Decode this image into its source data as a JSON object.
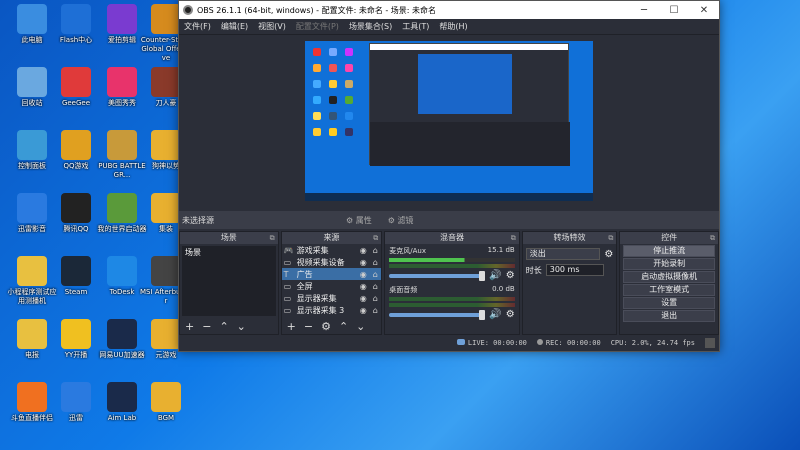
{
  "desktop": {
    "icons": [
      {
        "label": "此电脑",
        "icon": "computer-icon",
        "color": "#3a8de0"
      },
      {
        "label": "Flash中心",
        "icon": "flash-icon",
        "color": "#1e6fd6"
      },
      {
        "label": "爱拍剪辑",
        "icon": "scissors-icon",
        "color": "#7a3bd0"
      },
      {
        "label": "Counter-Strike Global Offensive",
        "icon": "cs-icon",
        "color": "#d68b1e"
      },
      {
        "label": "回收站",
        "icon": "recycle-bin-icon",
        "color": "#6aa8e0"
      },
      {
        "label": "GeeGee",
        "icon": "geegee-icon",
        "color": "#e03a3a"
      },
      {
        "label": "美图秀秀",
        "icon": "meitu-icon",
        "color": "#e8336b"
      },
      {
        "label": "刀人豪",
        "icon": "game-icon",
        "color": "#8a3a2a"
      },
      {
        "label": "控制面板",
        "icon": "control-panel-icon",
        "color": "#3a9ad6"
      },
      {
        "label": "QQ游戏",
        "icon": "qq-game-icon",
        "color": "#e0a020"
      },
      {
        "label": "PUBG BATTLEGR...",
        "icon": "pubg-icon",
        "color": "#c89a3a"
      },
      {
        "label": "狗神以势",
        "icon": "folder-icon",
        "color": "#e8b030"
      },
      {
        "label": "迅雷影音",
        "icon": "xunlei-icon",
        "color": "#2a7ae0"
      },
      {
        "label": "腾讯QQ",
        "icon": "qq-icon",
        "color": "#222222"
      },
      {
        "label": "我的世界启动器",
        "icon": "minecraft-icon",
        "color": "#5a9a3a"
      },
      {
        "label": "集装",
        "icon": "folder-icon",
        "color": "#e8b030"
      },
      {
        "label": "小程程序测试应用测播机",
        "icon": "file-icon",
        "color": "#e8c040"
      },
      {
        "label": "Steam",
        "icon": "steam-icon",
        "color": "#1b2838"
      },
      {
        "label": "ToDesk",
        "icon": "todesk-icon",
        "color": "#1e88e5"
      },
      {
        "label": "MSI Afterburner",
        "icon": "msi-icon",
        "color": "#444444"
      },
      {
        "label": "电报",
        "icon": "file-icon",
        "color": "#e8c040"
      },
      {
        "label": "YY开播",
        "icon": "yy-icon",
        "color": "#f0c020"
      },
      {
        "label": "网易UU加速器",
        "icon": "uu-icon",
        "color": "#1a2a4a"
      },
      {
        "label": "元游戏",
        "icon": "folder-icon",
        "color": "#e8b030"
      },
      {
        "label": "斗鱼直播伴侣",
        "icon": "douyu-icon",
        "color": "#f07020"
      },
      {
        "label": "迅雷",
        "icon": "xunlei-bird-icon",
        "color": "#2a7ae0"
      },
      {
        "label": "Aim Lab",
        "icon": "aimlab-icon",
        "color": "#1a2a4a"
      },
      {
        "label": "BGM",
        "icon": "folder-icon",
        "color": "#e8b030"
      }
    ]
  },
  "window": {
    "title": "OBS 26.1.1 (64-bit, windows) - 配置文件: 未命名 - 场景: 未命名",
    "minimize": "─",
    "maximize": "☐",
    "close": "✕"
  },
  "menu": [
    {
      "label": "文件(F)",
      "enabled": true
    },
    {
      "label": "编辑(E)",
      "enabled": true
    },
    {
      "label": "视图(V)",
      "enabled": true
    },
    {
      "label": "配置文件(P)",
      "enabled": false
    },
    {
      "label": "场景集合(S)",
      "enabled": true
    },
    {
      "label": "工具(T)",
      "enabled": true
    },
    {
      "label": "帮助(H)",
      "enabled": true
    }
  ],
  "source_bar": {
    "no_source": "未选择源",
    "properties": "属性",
    "filters": "滤镜"
  },
  "scenes": {
    "title": "场景",
    "items": [
      "场景"
    ]
  },
  "sources": {
    "title": "来源",
    "items": [
      {
        "name": "游戏采集",
        "icon": "gamepad-icon",
        "selected": false
      },
      {
        "name": "视频采集设备",
        "icon": "camera-icon",
        "selected": false
      },
      {
        "name": "广告",
        "icon": "text-icon",
        "selected": true
      },
      {
        "name": "全屏",
        "icon": "monitor-icon",
        "selected": false
      },
      {
        "name": "显示器采集",
        "icon": "monitor-icon",
        "selected": false
      },
      {
        "name": "显示器采集 3",
        "icon": "monitor-icon",
        "selected": false
      }
    ]
  },
  "mixer": {
    "title": "混音器",
    "channels": [
      {
        "name": "麦克风/Aux",
        "db": "15.1 dB"
      },
      {
        "name": "桌面音频",
        "db": "0.0 dB"
      }
    ]
  },
  "transitions": {
    "title": "转场特效",
    "selected": "淡出",
    "duration_label": "时长",
    "duration_value": "300 ms"
  },
  "controls": {
    "title": "控件",
    "buttons": [
      "停止推流",
      "开始录制",
      "启动虚拟摄像机",
      "工作室模式",
      "设置",
      "退出"
    ]
  },
  "status": {
    "live": "LIVE: 00:00:00",
    "rec": "REC: 00:00:00",
    "cpu": "CPU: 2.0%, 24.74 fps"
  },
  "colors": {
    "obs_bg": "#2b2e38",
    "selected": "#3a6ea5",
    "desktop": "#0f7ae8"
  }
}
